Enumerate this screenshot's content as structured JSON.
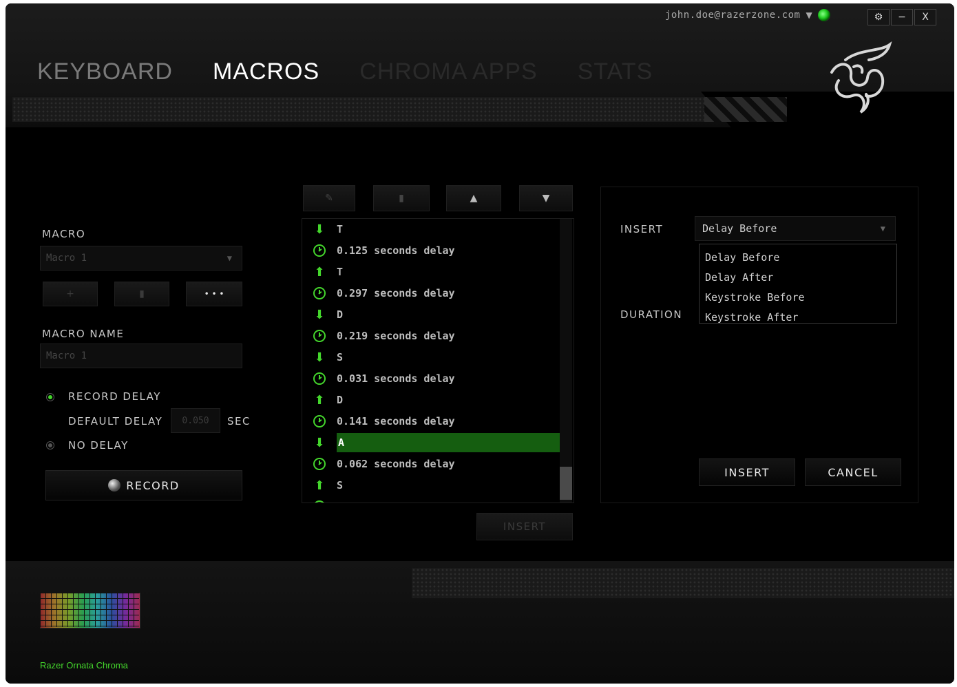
{
  "header": {
    "user_email": "john.doe@razerzone.com",
    "tabs": [
      {
        "label": "KEYBOARD"
      },
      {
        "label": "MACROS"
      },
      {
        "label": "CHROMA APPS"
      },
      {
        "label": "STATS"
      }
    ],
    "window_buttons": {
      "settings": "⚙",
      "minimize": "−",
      "close": "X"
    }
  },
  "macro_panel": {
    "macro_label": "MACRO",
    "macro_select_value": "Macro 1",
    "add_button": "+",
    "delete_button": "▮",
    "more_button": "• • •",
    "macro_name_label": "MACRO NAME",
    "macro_name_value": "Macro 1",
    "record_delay_label": "RECORD DELAY",
    "default_delay_label": "DEFAULT DELAY",
    "default_delay_value": "0.050",
    "sec_label": "SEC",
    "no_delay_label": "NO DELAY",
    "record_button": "RECORD"
  },
  "sequence": {
    "toolbar": [
      "edit-icon",
      "delete-icon",
      "move-up-icon",
      "move-down-icon"
    ],
    "items": [
      {
        "type": "key-down",
        "text": "T"
      },
      {
        "type": "delay",
        "text": "0.125 seconds delay"
      },
      {
        "type": "key-up",
        "text": "T"
      },
      {
        "type": "delay",
        "text": "0.297 seconds delay"
      },
      {
        "type": "key-down",
        "text": "D"
      },
      {
        "type": "delay",
        "text": "0.219 seconds delay"
      },
      {
        "type": "key-down",
        "text": "S"
      },
      {
        "type": "delay",
        "text": "0.031 seconds delay"
      },
      {
        "type": "key-up",
        "text": "D"
      },
      {
        "type": "delay",
        "text": "0.141 seconds delay"
      },
      {
        "type": "key-down",
        "text": "A",
        "selected": true
      },
      {
        "type": "delay",
        "text": "0.062 seconds delay"
      },
      {
        "type": "key-up",
        "text": "S"
      }
    ],
    "insert_button": "INSERT"
  },
  "insert_panel": {
    "insert_label": "INSERT",
    "insert_select_value": "Delay Before",
    "options": [
      "Delay Before",
      "Delay After",
      "Keystroke Before",
      "Keystroke After"
    ],
    "duration_label": "DURATION",
    "insert_button": "INSERT",
    "cancel_button": "CANCEL"
  },
  "footer": {
    "device_name": "Razer Ornata Chroma"
  },
  "colors": {
    "accent": "#44d62c",
    "selected_row": "#155e10",
    "background": "#000000"
  }
}
